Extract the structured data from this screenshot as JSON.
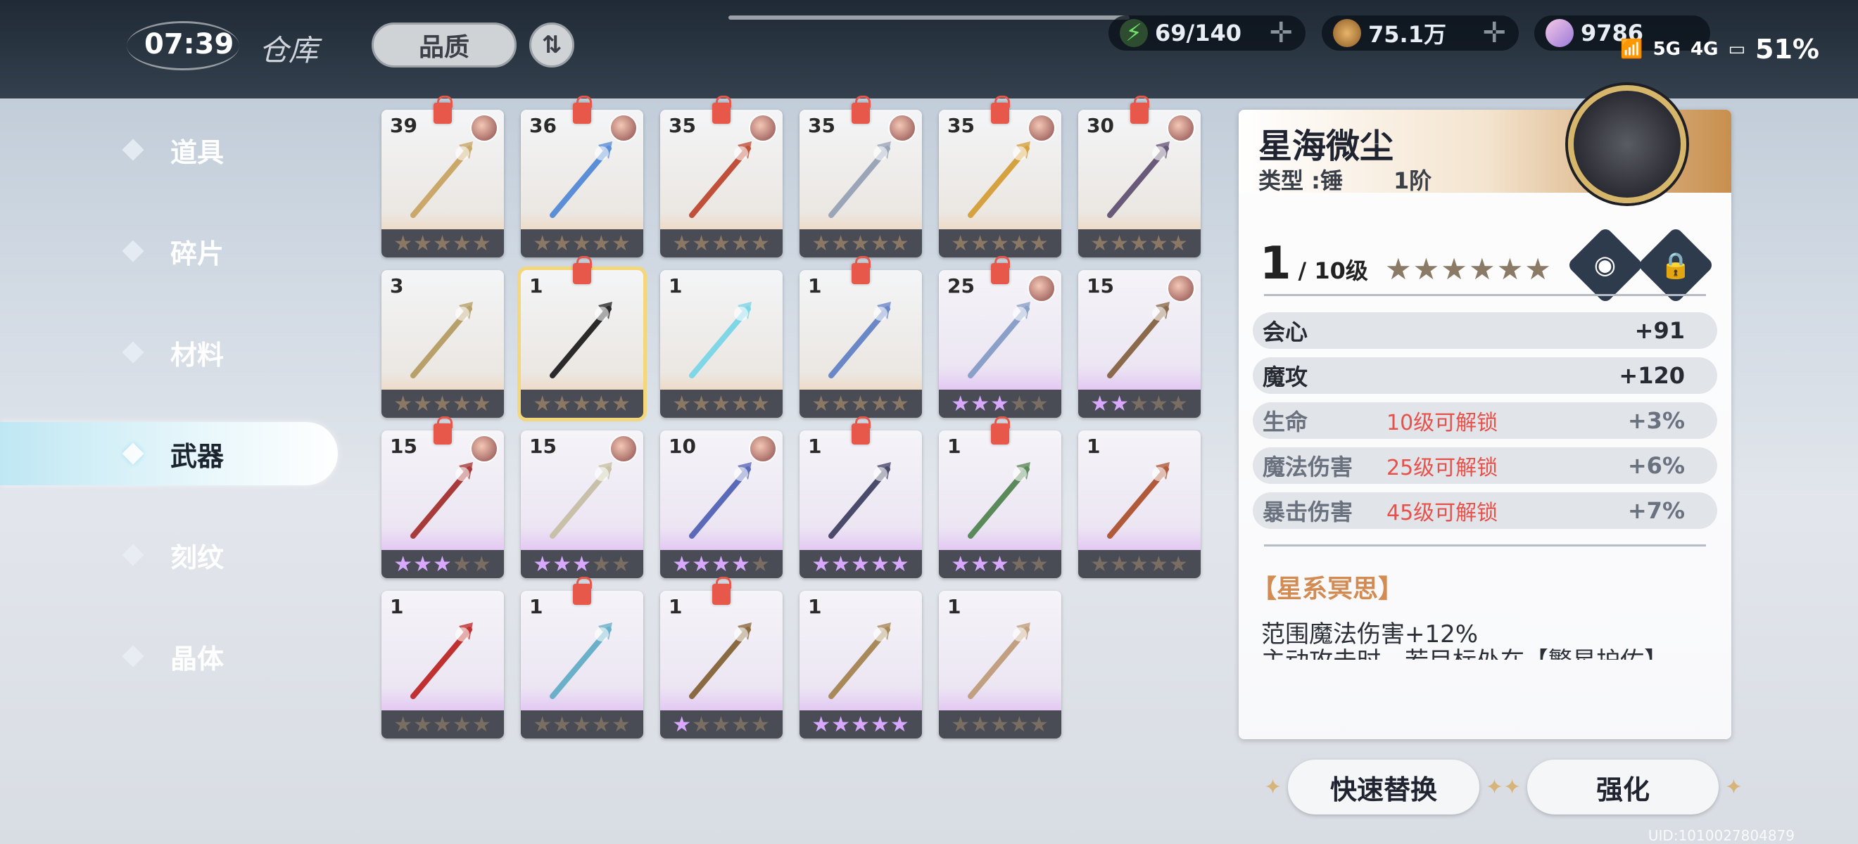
{
  "topbar": {
    "time": "07:39",
    "title": "仓库",
    "quality_label": "品质",
    "sort_icon": "sort-icon",
    "stamina": "69/140",
    "gold": "75.1万",
    "gems": "9786",
    "battery": "51%",
    "net1": "5G",
    "net2": "4G"
  },
  "sidebar": {
    "items": [
      {
        "label": "道具"
      },
      {
        "label": "碎片"
      },
      {
        "label": "材料"
      },
      {
        "label": "武器"
      },
      {
        "label": "刻纹"
      },
      {
        "label": "晶体"
      }
    ],
    "active_index": 3
  },
  "weapons": [
    {
      "level": "39",
      "stars": "★★★★★",
      "lit": 0,
      "style": "gold",
      "locked": true,
      "avatar": true
    },
    {
      "level": "36",
      "stars": "★★★★★",
      "lit": 0,
      "style": "gold",
      "locked": true,
      "avatar": true
    },
    {
      "level": "35",
      "stars": "★★★★★",
      "lit": 0,
      "style": "gold",
      "locked": true,
      "avatar": true
    },
    {
      "level": "35",
      "stars": "★★★★★",
      "lit": 0,
      "style": "gold",
      "locked": true,
      "avatar": true
    },
    {
      "level": "35",
      "stars": "★★★★★",
      "lit": 0,
      "style": "gold",
      "locked": true,
      "avatar": true
    },
    {
      "level": "30",
      "stars": "★★★★★",
      "lit": 0,
      "style": "gold",
      "locked": true,
      "avatar": true
    },
    {
      "level": "3",
      "stars": "★★★★★",
      "lit": 0,
      "style": "gold",
      "locked": false,
      "avatar": false
    },
    {
      "level": "1",
      "stars": "★★★★★",
      "lit": 0,
      "style": "gold",
      "locked": true,
      "avatar": false,
      "selected": true
    },
    {
      "level": "1",
      "stars": "★★★★★",
      "lit": 0,
      "style": "gold",
      "locked": false,
      "avatar": false
    },
    {
      "level": "1",
      "stars": "★★★★★",
      "lit": 0,
      "style": "gold",
      "locked": true,
      "avatar": false
    },
    {
      "level": "25",
      "stars": "★★★★★",
      "lit": 3,
      "style": "purple",
      "locked": true,
      "avatar": true
    },
    {
      "level": "15",
      "stars": "★★★★★",
      "lit": 2,
      "style": "purple",
      "locked": false,
      "avatar": true
    },
    {
      "level": "15",
      "stars": "★★★★★",
      "lit": 3,
      "style": "purple",
      "locked": true,
      "avatar": true
    },
    {
      "level": "15",
      "stars": "★★★★★",
      "lit": 3,
      "style": "purple",
      "locked": false,
      "avatar": true
    },
    {
      "level": "10",
      "stars": "★★★★★",
      "lit": 4,
      "style": "purple",
      "locked": false,
      "avatar": true
    },
    {
      "level": "1",
      "stars": "★★★★★",
      "lit": 5,
      "style": "purple",
      "locked": true,
      "avatar": false
    },
    {
      "level": "1",
      "stars": "★★★★★",
      "lit": 3,
      "style": "purple",
      "locked": true,
      "avatar": false
    },
    {
      "level": "1",
      "stars": "★★★★★",
      "lit": 0,
      "style": "purple",
      "locked": false,
      "avatar": false
    },
    {
      "level": "1",
      "stars": "★★★★★",
      "lit": 0,
      "style": "purple",
      "locked": false,
      "avatar": false
    },
    {
      "level": "1",
      "stars": "★★★★★",
      "lit": 0,
      "style": "purple",
      "locked": true,
      "avatar": false
    },
    {
      "level": "1",
      "stars": "★★★★★",
      "lit": 1,
      "style": "purple",
      "locked": true,
      "avatar": false
    },
    {
      "level": "1",
      "stars": "★★★★★",
      "lit": 5,
      "style": "purple",
      "locked": false,
      "avatar": false
    },
    {
      "level": "1",
      "stars": "★★★★★",
      "lit": 0,
      "style": "purple",
      "locked": false,
      "avatar": false
    }
  ],
  "detail": {
    "name": "星海微尘",
    "type": "类型 :锤",
    "tier": "1阶",
    "level": "1",
    "max_level": "/ 10级",
    "stars": "★★★★★★",
    "stats": [
      {
        "name": "会心",
        "value": "+91",
        "unlock": "",
        "locked": false
      },
      {
        "name": "魔攻",
        "value": "+120",
        "unlock": "",
        "locked": false
      },
      {
        "name": "生命",
        "value": "+3%",
        "unlock": "10级可解锁",
        "locked": true
      },
      {
        "name": "魔法伤害",
        "value": "+6%",
        "unlock": "25级可解锁",
        "locked": true
      },
      {
        "name": "暴击伤害",
        "value": "+7%",
        "unlock": "45级可解锁",
        "locked": true
      }
    ],
    "section_title": "【星系冥思】",
    "section_text": "范围魔法伤害+12%",
    "section_text_cut": "主动攻击时，若目标处在【繁星护佑】"
  },
  "actions": {
    "replace": "快速替换",
    "enhance": "强化"
  },
  "uid": "UID:1010027804879"
}
